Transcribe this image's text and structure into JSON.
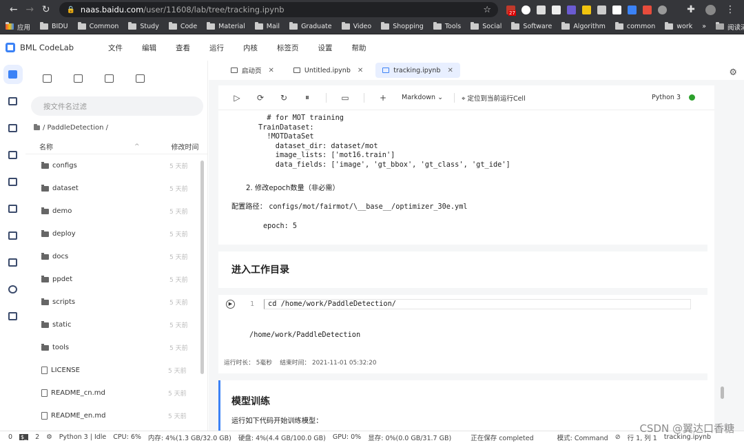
{
  "browser": {
    "url_host": "naas.baidu.com",
    "url_path": "/user/11608/lab/tree/tracking.ipynb",
    "ext_badge": "27",
    "bookmarks": [
      {
        "label": "应用",
        "type": "grid"
      },
      {
        "label": "BIDU",
        "type": "folder"
      },
      {
        "label": "Common",
        "type": "folder"
      },
      {
        "label": "Study",
        "type": "folder"
      },
      {
        "label": "Code",
        "type": "folder"
      },
      {
        "label": "Material",
        "type": "folder"
      },
      {
        "label": "Mail",
        "type": "folder"
      },
      {
        "label": "Graduate",
        "type": "folder"
      },
      {
        "label": "Video",
        "type": "folder"
      },
      {
        "label": "Shopping",
        "type": "folder"
      },
      {
        "label": "Tools",
        "type": "folder"
      },
      {
        "label": "Social",
        "type": "folder"
      },
      {
        "label": "Software",
        "type": "folder"
      },
      {
        "label": "Algorithm",
        "type": "folder"
      },
      {
        "label": "common",
        "type": "folder"
      },
      {
        "label": "work",
        "type": "folder"
      }
    ],
    "more": "»",
    "reading_list": "阅读清单"
  },
  "app": {
    "name": "BML CodeLab",
    "menu": [
      "文件",
      "编辑",
      "查看",
      "运行",
      "内核",
      "标签页",
      "设置",
      "帮助"
    ]
  },
  "filebrowser": {
    "filter_placeholder": "按文件名过滤",
    "breadcrumb": "/ PaddleDetection /",
    "col_name": "名称",
    "col_modified": "修改时间",
    "items": [
      {
        "name": "configs",
        "time": "5 天前",
        "kind": "folder"
      },
      {
        "name": "dataset",
        "time": "5 天前",
        "kind": "folder"
      },
      {
        "name": "demo",
        "time": "5 天前",
        "kind": "folder"
      },
      {
        "name": "deploy",
        "time": "5 天前",
        "kind": "folder"
      },
      {
        "name": "docs",
        "time": "5 天前",
        "kind": "folder"
      },
      {
        "name": "ppdet",
        "time": "5 天前",
        "kind": "folder"
      },
      {
        "name": "scripts",
        "time": "5 天前",
        "kind": "folder"
      },
      {
        "name": "static",
        "time": "5 天前",
        "kind": "folder"
      },
      {
        "name": "tools",
        "time": "5 天前",
        "kind": "folder"
      },
      {
        "name": "LICENSE",
        "time": "5 天前",
        "kind": "file"
      },
      {
        "name": "README_cn.md",
        "time": "5 天前",
        "kind": "file"
      },
      {
        "name": "README_en.md",
        "time": "5 天前",
        "kind": "file"
      }
    ]
  },
  "tabs": [
    {
      "label": "启动页",
      "active": false
    },
    {
      "label": "Untitled.ipynb",
      "active": false
    },
    {
      "label": "tracking.ipynb",
      "active": true
    }
  ],
  "notebook": {
    "cell_type": "Markdown",
    "locate_label": "定位到当前运行Cell",
    "kernel": "Python 3",
    "yaml_block": "  # for MOT training\nTrainDataset:\n  !MOTDataSet\n    dataset_dir: dataset/mot\n    image_lists: ['mot16.train']\n    data_fields: ['image', 'gt_bbox', 'gt_class', 'gt_ide']",
    "step2": "2. 修改epoch数量（非必需）",
    "config_label": "配置路径：",
    "config_path": "configs/mot/fairmot/\\__base__/optimizer_30e.yml",
    "epoch_line": "epoch: 5",
    "heading1": "进入工作目录",
    "line_no": "1",
    "code": "cd /home/work/PaddleDetection/",
    "output": "/home/work/PaddleDetection",
    "runtime_label": "运行时长：",
    "runtime_value": "5毫秒",
    "endtime_label": "结束时间：",
    "endtime_value": "2021-11-01 05:32:20",
    "heading2": "模型训练",
    "train_text": "运行如下代码开始训练模型："
  },
  "status": {
    "a": "0",
    "b": "2",
    "kernel": "Python 3 | Idle",
    "cpu": "CPU:  6%",
    "mem": "内存:  4%(1.3 GB/32.0 GB)",
    "disk": "硬盘:  4%(4.4 GB/100.0 GB)",
    "gpu": "GPU:  0%",
    "vram": "显存:  0%(0.0 GB/31.7 GB)",
    "saving": "正在保存 completed",
    "mode": "模式: Command",
    "pos": "行 1, 列 1",
    "file": "tracking.ipynb"
  },
  "watermark": "CSDN @翼达口香糖"
}
